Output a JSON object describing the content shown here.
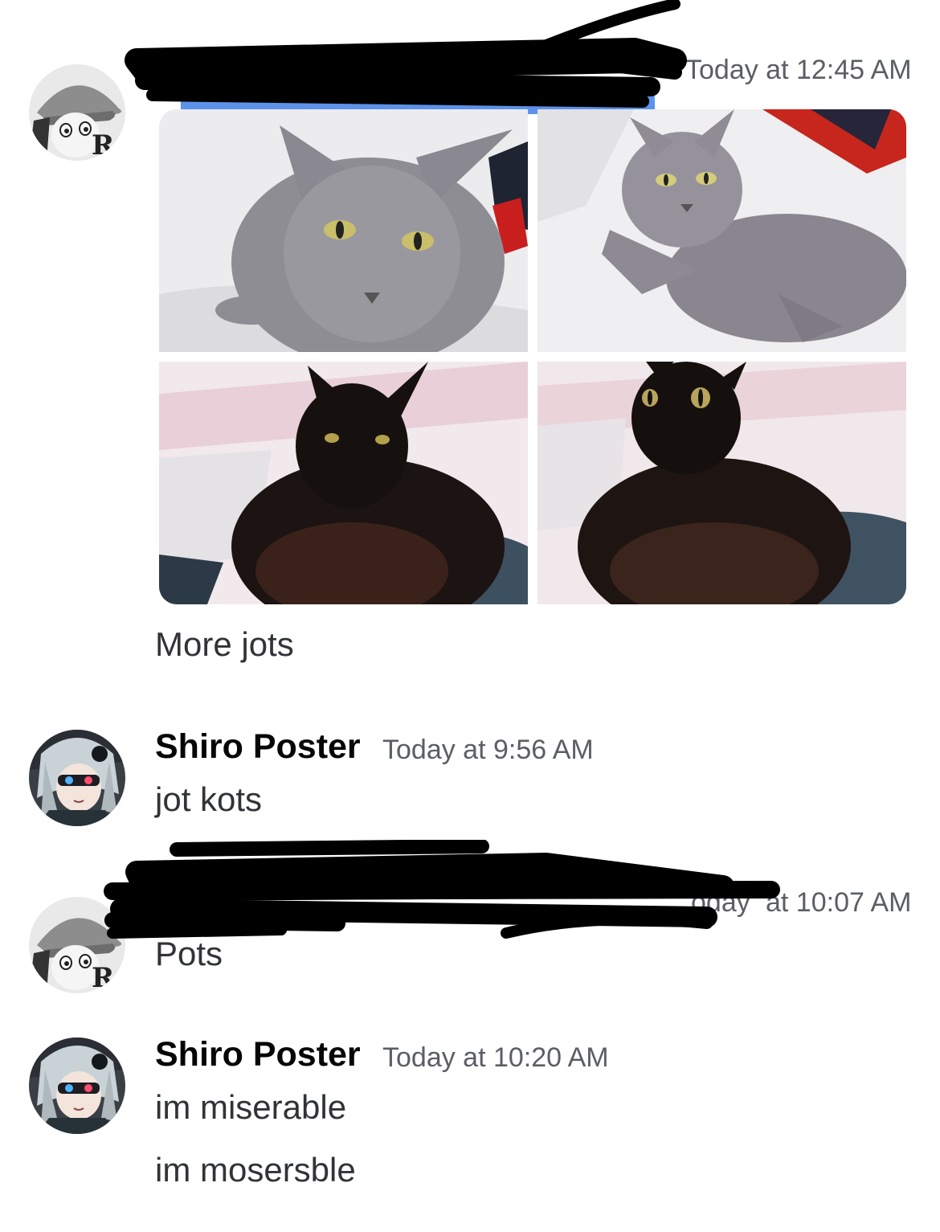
{
  "messages": [
    {
      "author": "",
      "timestamp": "Today at 12:45 AM",
      "attachments": [
        {
          "subject": "gray-cat"
        },
        {
          "subject": "gray-cat"
        },
        {
          "subject": "black-cat"
        },
        {
          "subject": "black-cat"
        }
      ],
      "lines": [
        "More jots"
      ]
    },
    {
      "author": "Shiro Poster",
      "timestamp": "Today at 9:56 AM",
      "lines": [
        "jot kots"
      ]
    },
    {
      "author": "",
      "timestamp": "at 10:07 AM",
      "timestamp_partial": "oday",
      "lines": [
        "Pots"
      ]
    },
    {
      "author": "Shiro Poster",
      "timestamp": "Today at 10:20 AM",
      "lines": [
        "im miserable",
        "im mosersble"
      ]
    }
  ],
  "colors": {
    "username": "#060607",
    "timestamp": "#5c5e66",
    "text": "#313338",
    "redaction": "#000000",
    "highlight": "#4a86e8"
  }
}
